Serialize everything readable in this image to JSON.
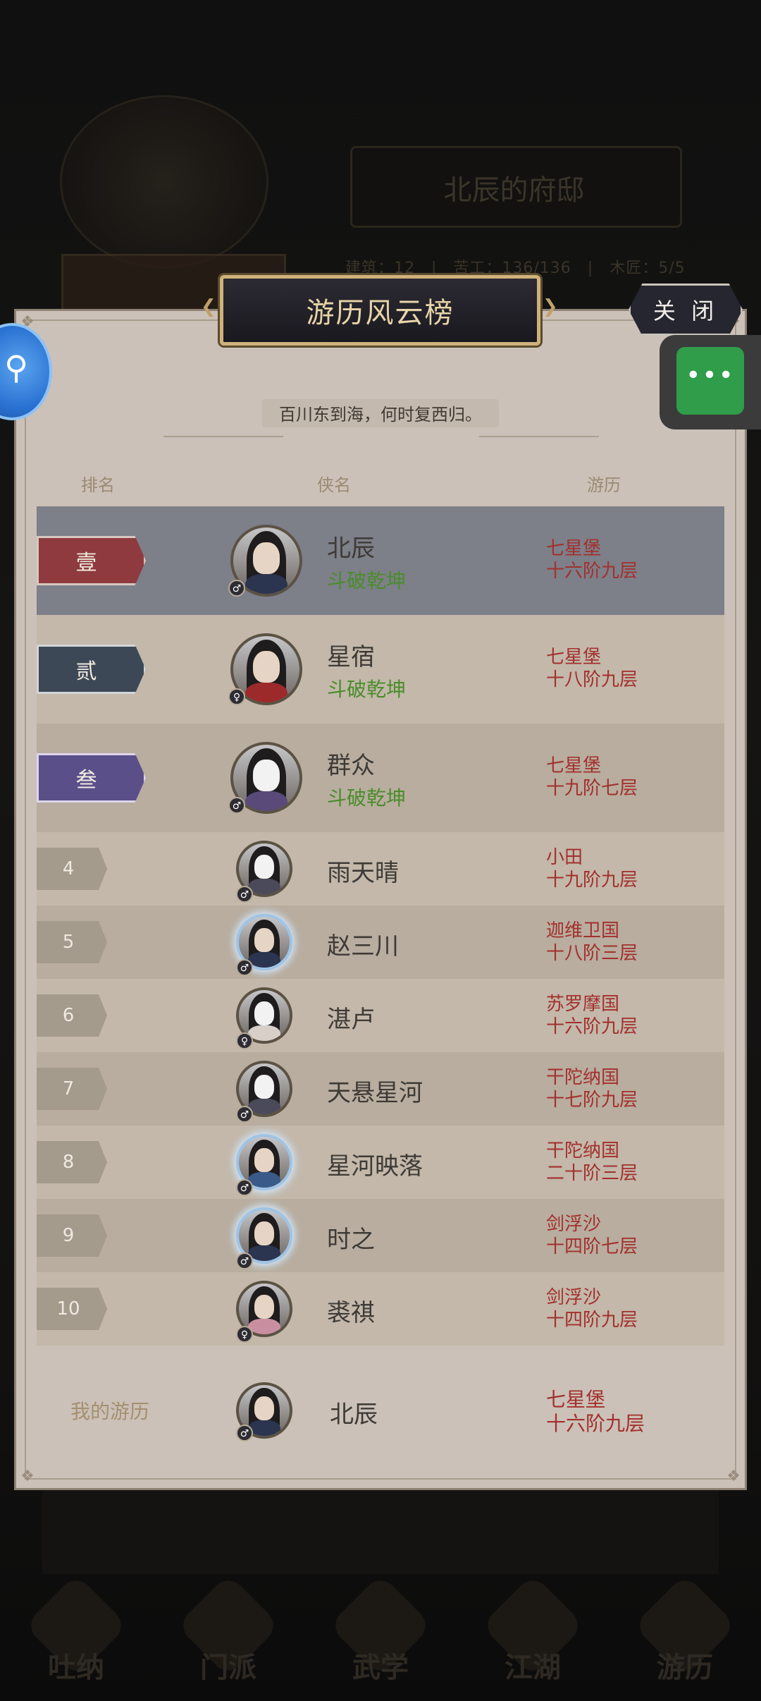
{
  "background": {
    "residence_title": "北辰的府邸",
    "stats": "建筑：12　|　苦工：136/136　|　木匠：5/5",
    "nav": [
      "吐纳",
      "门派",
      "武学",
      "江湖",
      "游历"
    ]
  },
  "panel": {
    "title": "游历风云榜",
    "close_label": "关 闭",
    "motto": "百川东到海，何时复西归。",
    "columns": {
      "rank": "排名",
      "name": "侠名",
      "travel": "游历"
    }
  },
  "menu_dots": "•••",
  "rows": [
    {
      "rank": "壹",
      "name": "北辰",
      "title": "斗破乾坤",
      "gender": "♂",
      "loc1": "七星堡",
      "loc2": "十六阶九层"
    },
    {
      "rank": "贰",
      "name": "星宿",
      "title": "斗破乾坤",
      "gender": "♀",
      "loc1": "七星堡",
      "loc2": "十八阶九层"
    },
    {
      "rank": "叁",
      "name": "群众",
      "title": "斗破乾坤",
      "gender": "♂",
      "loc1": "七星堡",
      "loc2": "十九阶七层"
    },
    {
      "rank": "4",
      "name": "雨天晴",
      "gender": "♂",
      "loc1": "小田",
      "loc2": "十九阶九层"
    },
    {
      "rank": "5",
      "name": "赵三川",
      "gender": "♂",
      "loc1": "迦维卫国",
      "loc2": "十八阶三层"
    },
    {
      "rank": "6",
      "name": "湛卢",
      "gender": "♀",
      "loc1": "苏罗摩国",
      "loc2": "十六阶九层"
    },
    {
      "rank": "7",
      "name": "天悬星河",
      "gender": "♂",
      "loc1": "干陀纳国",
      "loc2": "十七阶九层"
    },
    {
      "rank": "8",
      "name": "星河映落",
      "gender": "♂",
      "loc1": "干陀纳国",
      "loc2": "二十阶三层"
    },
    {
      "rank": "9",
      "name": "时之",
      "gender": "♂",
      "loc1": "剑浮沙",
      "loc2": "十四阶七层"
    },
    {
      "rank": "10",
      "name": "裘祺",
      "gender": "♀",
      "loc1": "剑浮沙",
      "loc2": "十四阶九层"
    }
  ],
  "mine": {
    "label": "我的游历",
    "name": "北辰",
    "gender": "♂",
    "loc1": "七星堡",
    "loc2": "十六阶九层"
  }
}
